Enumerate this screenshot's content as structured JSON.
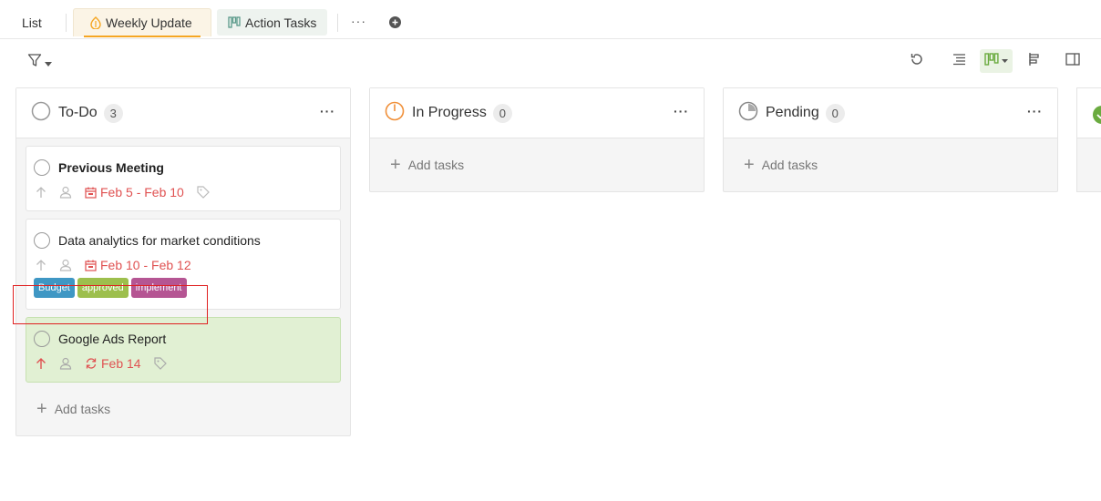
{
  "tabs": {
    "list": "List",
    "weekly_update": "Weekly Update",
    "action_tasks": "Action Tasks",
    "more": "···"
  },
  "columns": [
    {
      "title": "To-Do",
      "count": "3",
      "more": "···",
      "add_label": "Add tasks",
      "cards": [
        {
          "title": "Previous Meeting",
          "date": "Feb 5 - Feb 10"
        },
        {
          "title": "Data analytics for market conditions",
          "date": "Feb 10 - Feb 12",
          "tags": [
            {
              "label": "Budget",
              "color": "#3f97c4"
            },
            {
              "label": "approved",
              "color": "#9dbf4d"
            },
            {
              "label": "implement",
              "color": "#b55593"
            }
          ]
        },
        {
          "title": "Google Ads Report",
          "date": "Feb 14"
        }
      ]
    },
    {
      "title": "In Progress",
      "count": "0",
      "more": "···",
      "add_label": "Add tasks"
    },
    {
      "title": "Pending",
      "count": "0",
      "more": "···",
      "add_label": "Add tasks"
    }
  ],
  "colors": {
    "accent_orange": "#f5a623",
    "accent_green": "#6aab3f",
    "date_red": "#e05252",
    "highlight_card": "#e1f0d3"
  }
}
